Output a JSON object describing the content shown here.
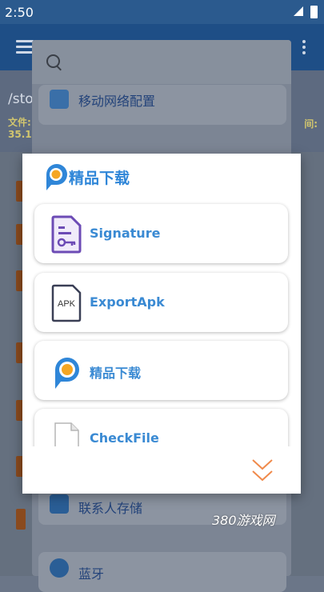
{
  "status_bar": {
    "time": "2:50"
  },
  "background": {
    "path": "/sto",
    "info_left_line1": "文件:",
    "info_left_line2": "35.1",
    "info_right": "间:"
  },
  "drawer": {
    "items": [
      {
        "label": "移动网络配置"
      },
      {
        "label": "联系人存储"
      },
      {
        "label": "蓝牙"
      }
    ]
  },
  "modal": {
    "title": "精品下载",
    "items": [
      {
        "label": "Signature",
        "icon": "signature-key-icon"
      },
      {
        "label": "ExportApk",
        "icon": "apk-file-icon",
        "icon_text": "APK"
      },
      {
        "label": "精品下载",
        "icon": "p-logo-icon"
      },
      {
        "label": "CheckFile",
        "icon": "blank-file-icon"
      }
    ],
    "accent": "#2f86d8",
    "chevron_color": "#f08a4b"
  },
  "watermark": "380游戏网"
}
